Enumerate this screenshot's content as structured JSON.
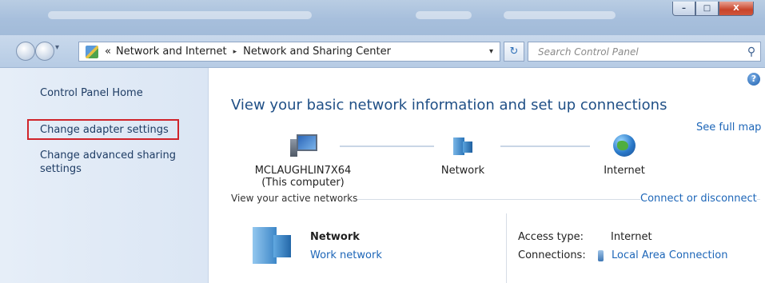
{
  "window": {
    "minimize_label": "–",
    "maximize_label": "□",
    "close_label": "X"
  },
  "address_bar": {
    "overflow_marker": "«",
    "crumbs": [
      "Network and Internet",
      "Network and Sharing Center"
    ],
    "separator": "▸",
    "search_placeholder": "Search Control Panel"
  },
  "sidebar": {
    "home": "Control Panel Home",
    "items": [
      {
        "label": "Change adapter settings",
        "highlighted": true
      },
      {
        "label": "Change advanced sharing settings"
      }
    ],
    "highlight_color": "#d0242b"
  },
  "main": {
    "title": "View your basic network information and set up connections",
    "see_full_map": "See full map",
    "map_nodes": [
      {
        "name": "MCLAUGHLIN7X64",
        "sub": "(This computer)",
        "icon": "computer-icon"
      },
      {
        "name": "Network",
        "icon": "network-icon"
      },
      {
        "name": "Internet",
        "icon": "globe-icon"
      }
    ],
    "active_networks_label": "View your active networks",
    "connect_link": "Connect or disconnect",
    "network": {
      "name": "Network",
      "type": "Work network",
      "access_type_label": "Access type:",
      "access_type_value": "Internet",
      "connections_label": "Connections:",
      "connections_value": "Local Area Connection"
    }
  },
  "colors": {
    "link": "#1d66b8",
    "title": "#1f4f86",
    "sidebar_bg": "#e6eef8"
  }
}
